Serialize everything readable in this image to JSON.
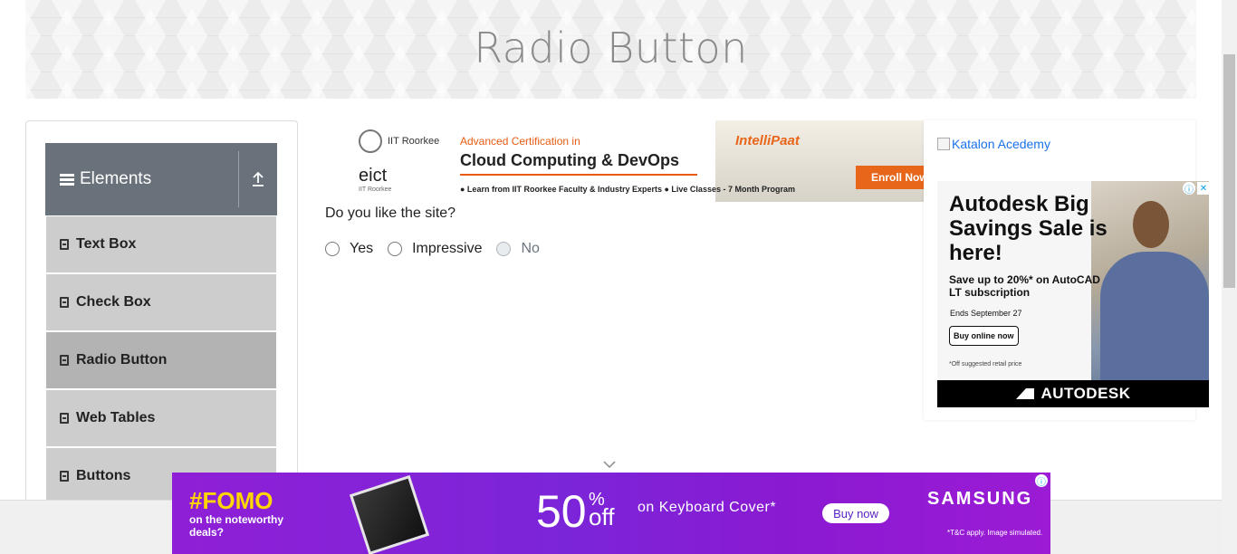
{
  "header": {
    "title": "Radio Button"
  },
  "sidebar": {
    "group_title": "Elements",
    "items": [
      {
        "label": "Text Box"
      },
      {
        "label": "Check Box"
      },
      {
        "label": "Radio Button",
        "active": true
      },
      {
        "label": "Web Tables"
      },
      {
        "label": "Buttons"
      }
    ]
  },
  "ad_top": {
    "org1": "IIT Roorkee",
    "org2": "eict",
    "org2_sub": "IIT Roorkee",
    "cert_line": "Advanced Certification in",
    "course": "Cloud Computing & DevOps",
    "learn": "● Learn from IIT Roorkee Faculty & Industry Experts   ● Live Classes - 7 Month Program",
    "brand": "IntelliPaat",
    "enroll": "Enroll Now"
  },
  "main": {
    "question": "Do you like the site?",
    "options": [
      {
        "label": "Yes",
        "disabled": false
      },
      {
        "label": "Impressive",
        "disabled": false
      },
      {
        "label": "No",
        "disabled": true
      }
    ]
  },
  "ad_right": {
    "broken_image_alt": "Katalon Acedemy",
    "headline": "Autodesk Big Savings Sale is here!",
    "sub": "Save up to 20%* on AutoCAD LT subscription",
    "ends": "Ends September 27",
    "button": "Buy online now",
    "fine_print": "*Off suggested retail price",
    "logo": "AUTODESK"
  },
  "ad_bottom": {
    "fomo": "#FOMO",
    "fomo_sub": "on the noteworthy deals?",
    "big": "50",
    "pct": "%",
    "off": "off",
    "offer": "on Keyboard Cover*",
    "button": "Buy now",
    "brand": "SAMSUNG",
    "tc": "*T&C apply. Image simulated."
  },
  "colors": {
    "sidebar_header": "#69727b",
    "menu_item": "#cdcdcd",
    "menu_active": "#b3b3b3",
    "ad_purple": "#7b25d9"
  }
}
